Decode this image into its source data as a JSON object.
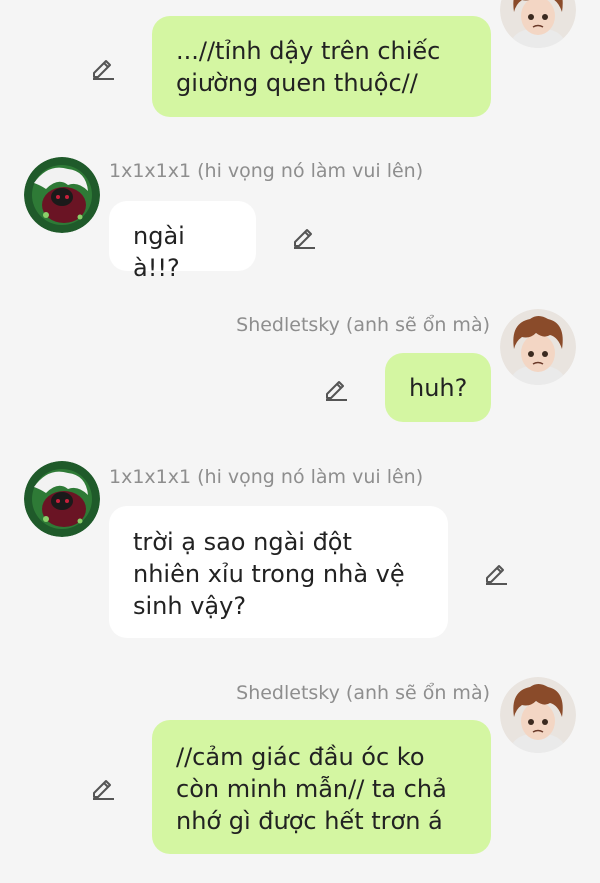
{
  "contacts": {
    "me": {
      "name": "Shedletsky (anh sẽ ổn mà)",
      "avatar_icon": "brown-haired-boy-avatar-icon"
    },
    "other": {
      "name": "1x1x1x1 (hi vọng nó làm vui lên)",
      "avatar_icon": "white-haired-green-eye-avatar-icon"
    }
  },
  "messages": [
    {
      "sender": "me",
      "show_name": false,
      "text": "...//tỉnh dậy trên chiếc giường quen thuộc//"
    },
    {
      "sender": "other",
      "show_name": true,
      "text": "ngài à!!?"
    },
    {
      "sender": "me",
      "show_name": true,
      "text": "huh?"
    },
    {
      "sender": "other",
      "show_name": true,
      "text": "trời ạ sao ngài đột nhiên xỉu trong nhà vệ sinh vậy?"
    },
    {
      "sender": "me",
      "show_name": true,
      "text": "//cảm giác đầu óc ko còn minh mẫn// ta chả nhớ gì được hết trơn á"
    }
  ],
  "colors": {
    "background": "#f5f5f5",
    "my_bubble": "#d4f6a2",
    "their_bubble": "#ffffff",
    "name_text": "#8e8e8e",
    "icon": "#555555"
  },
  "icons": {
    "edit": "pencil-edit-icon"
  }
}
